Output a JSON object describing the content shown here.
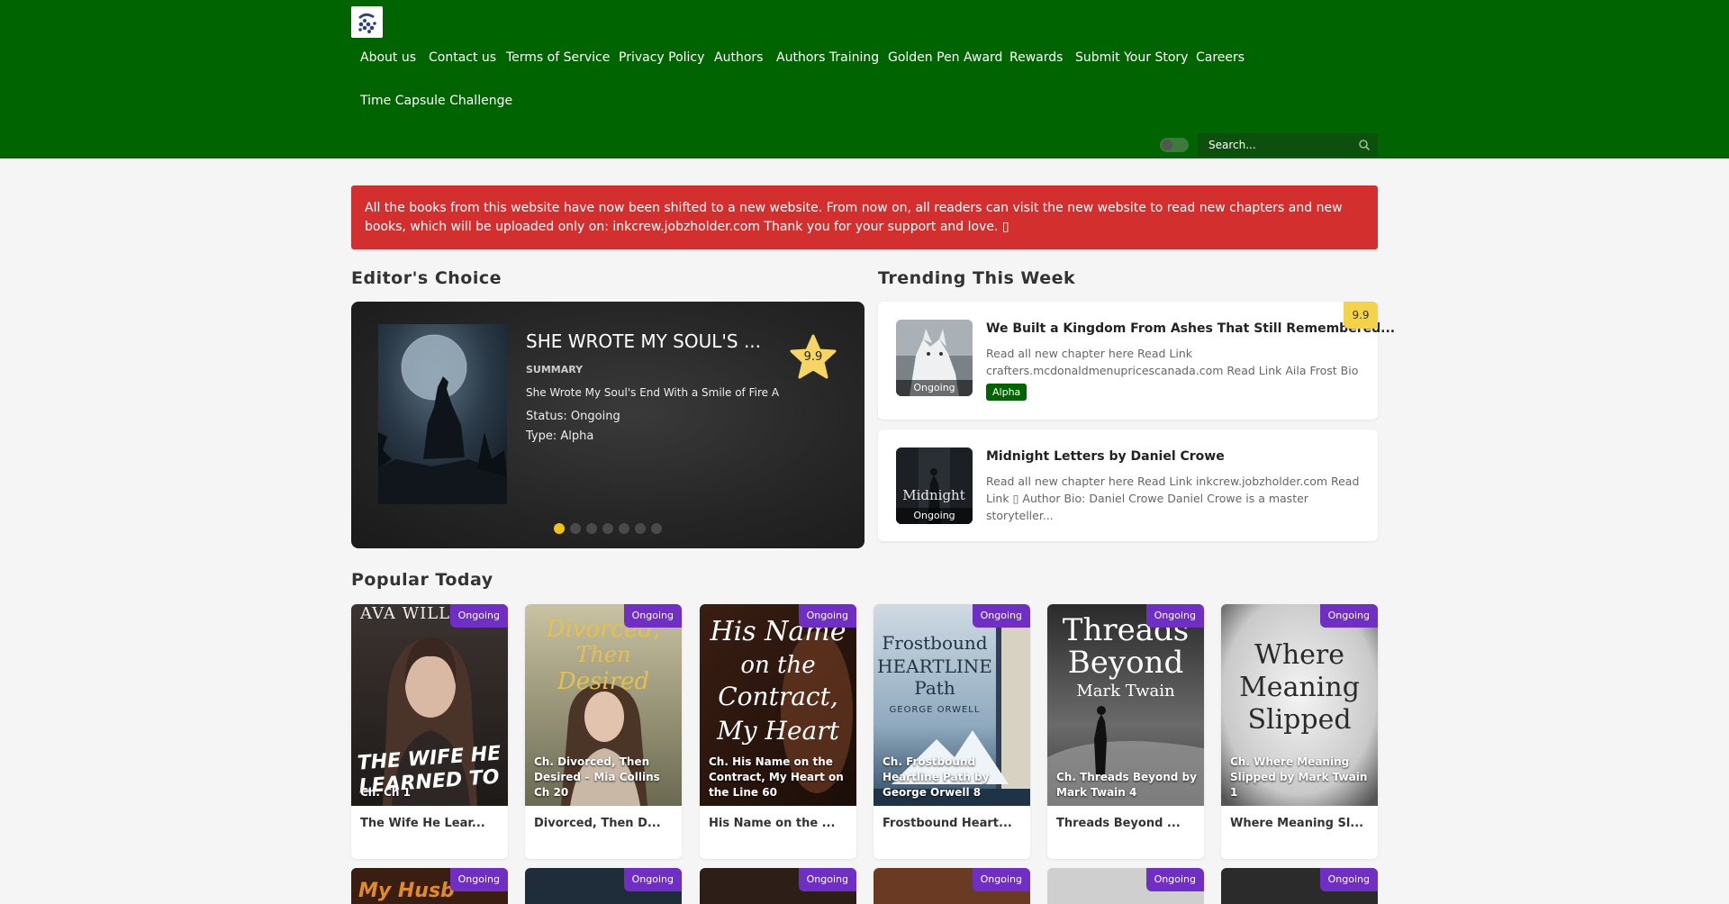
{
  "header": {
    "nav": [
      {
        "label": "About us"
      },
      {
        "label": "Contact us"
      },
      {
        "label": "Terms of Service"
      },
      {
        "label": "Privacy Policy"
      },
      {
        "label": "Authors"
      },
      {
        "label": "Authors Training"
      },
      {
        "label": "Golden Pen Award"
      },
      {
        "label": "Rewards"
      },
      {
        "label": "Submit Your Story"
      },
      {
        "label": "Careers"
      },
      {
        "label": "Time Capsule Challenge"
      }
    ],
    "search_placeholder": "Search..."
  },
  "alert": {
    "text": "All the books from this website have now been shifted to a new website. From now on, all readers can visit the new website to read new chapters and new books, which will be uploaded only on: inkcrew.jobzholder.com Thank you for your support and love. ▯"
  },
  "editors_choice": {
    "heading": "Editor's Choice",
    "title": "SHE WROTE MY SOUL'S ...",
    "summary_label": "SUMMARY",
    "summary": "She Wrote My Soul's End With a Smile of Fire A",
    "status": "Status: Ongoing",
    "type": "Type: Alpha",
    "score": "9.9",
    "slide_count": 7,
    "active_slide": 1
  },
  "trending": {
    "heading": "Trending This Week",
    "items": [
      {
        "title": "We Built a Kingdom From Ashes That Still Remembered...",
        "desc": "Read all new chapter here Read Link crafters.mcdonaldmenupricescanada.com Read Link Aila Frost Bio —...",
        "thumb_label": "Ongoing",
        "tag": "Alpha",
        "score": "9.9"
      },
      {
        "title": "Midnight Letters by Daniel Crowe",
        "desc": "Read all new chapter here Read Link  inkcrew.jobzholder.com  Read Link  ▯ Author Bio: Daniel Crowe  Daniel Crowe is a master storyteller...",
        "thumb_label": "Ongoing",
        "cover_text": "Midnight"
      }
    ]
  },
  "popular": {
    "heading": "Popular Today",
    "items": [
      {
        "badge": "Ongoing",
        "chapter": "Ch. Ch 1",
        "name": "The Wife He Lear...",
        "cover_top": "AVA WILL",
        "cover_main": "THE WIFE HE LEARNED TO"
      },
      {
        "badge": "Ongoing",
        "chapter": "Ch. Divorced, Then Desired – Mia Collins Ch 20",
        "name": "Divorced, Then D...",
        "cover_main": "Divorced, Then Desired"
      },
      {
        "badge": "Ongoing",
        "chapter": "Ch. His Name on the Contract, My Heart on the Line 60",
        "name": "His Name on the ...",
        "cover_main": "His Name on the Contract, My Heart on the Line"
      },
      {
        "badge": "Ongoing",
        "chapter": "Ch. Frostbound Heartline Path by George Orwell 8",
        "name": "Frostbound Heart...",
        "cover_main": "Frostbound HEARTLINE Path",
        "cover_author": "GEORGE ORWELL"
      },
      {
        "badge": "Ongoing",
        "chapter": "Ch. Threads Beyond by Mark Twain 4",
        "name": "Threads Beyond ...",
        "cover_main": "Threads Beyond",
        "cover_author": "Mark Twain"
      },
      {
        "badge": "Ongoing",
        "chapter": "Ch. Where Meaning Slipped by Mark Twain 1",
        "name": "Where Meaning Sl...",
        "cover_main": "Where Meaning Slipped"
      }
    ],
    "row2": [
      {
        "badge": "Ongoing",
        "cover_main": "My Husb"
      },
      {
        "badge": "Ongoing"
      },
      {
        "badge": "Ongoing"
      },
      {
        "badge": "Ongoing"
      },
      {
        "badge": "Ongoing"
      },
      {
        "badge": "Ongoing"
      }
    ]
  }
}
